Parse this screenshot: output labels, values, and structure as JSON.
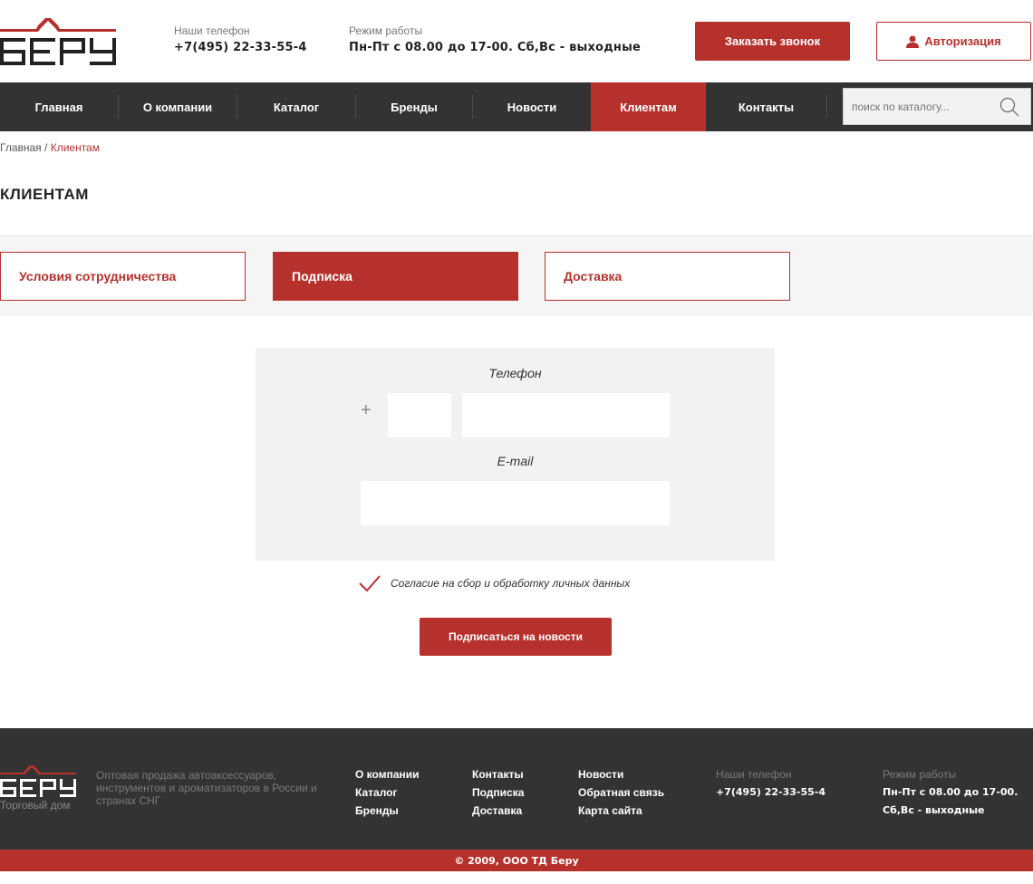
{
  "header": {
    "phone_label": "Наши телефон",
    "phone_value": "+7(495) 22-33-55-4",
    "hours_label": "Режим работы",
    "hours_value": "Пн-Пт с 08.00 до 17-00. Сб,Вс - выходные",
    "call_button": "Заказать звонок",
    "auth_button": "Авторизация"
  },
  "nav": {
    "items": [
      "Главная",
      "О компании",
      "Каталог",
      "Бренды",
      "Новости",
      "Клиентам",
      "Контакты"
    ],
    "active": "Клиентам",
    "search_placeholder": "поиск по каталогу..."
  },
  "breadcrumb": {
    "home": "Главная",
    "separator": " / ",
    "current": "Клиентам"
  },
  "page_title": "КЛИЕНТАМ",
  "tabs": {
    "items": [
      "Условия сотрудничества",
      "Подписка",
      "Доставка"
    ],
    "active": "Подписка"
  },
  "form": {
    "phone_label": "Телефон",
    "phone_prefix": "+",
    "code_value": "",
    "number_value": "",
    "email_label": "E-mail",
    "email_value": "",
    "consent_text": "Согласие на сбор и обработку личных данных",
    "consent_checked": true,
    "submit_button": "Подписаться на новости"
  },
  "footer": {
    "logo_sub": "Торговый дом",
    "description": "Оптовая продажа автоаксессуаров, инструментов и ароматизаторов в России и странах СНГ",
    "links_col1": [
      "О компании",
      "Каталог",
      "Бренды"
    ],
    "links_col2": [
      "Контакты",
      "Подписка",
      "Доставка"
    ],
    "links_col3": [
      "Новости",
      "Обратная связь",
      "Карта сайта"
    ],
    "phone_label": "Наши телефон",
    "phone_value": "+7(495) 22-33-55-4",
    "hours_label": "Режим работы",
    "hours_value_1": "Пн-Пт с 08.00 до 17-00.",
    "hours_value_2": "Сб,Вс - выходные",
    "copyright": "© 2009, ООО ТД Беру"
  },
  "colors": {
    "accent": "#b7312c",
    "dark": "#333333",
    "light_bg": "#f5f5f5"
  },
  "icons": [
    "logo",
    "user-icon",
    "search-icon",
    "checkmark-icon"
  ]
}
